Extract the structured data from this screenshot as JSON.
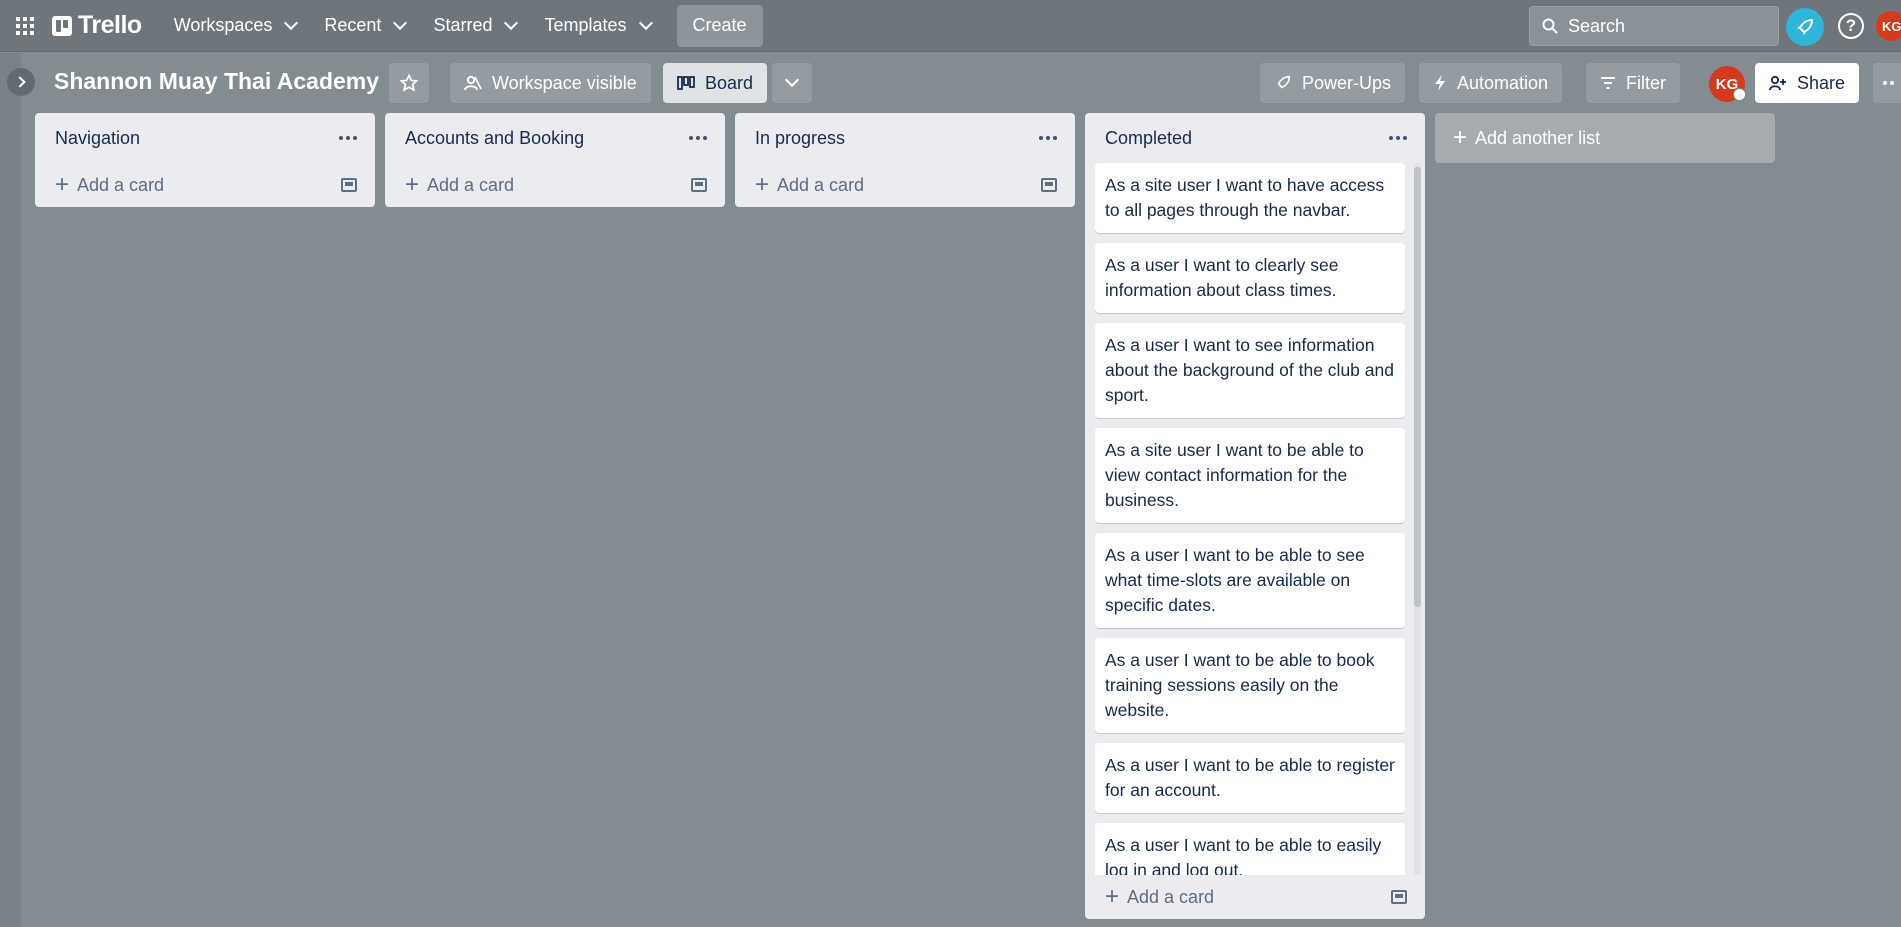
{
  "topbar": {
    "logo_text": "Trello",
    "nav": [
      "Workspaces",
      "Recent",
      "Starred",
      "Templates"
    ],
    "create_label": "Create",
    "search_placeholder": "Search",
    "avatar_initials": "KG"
  },
  "board": {
    "title": "Shannon Muay Thai Academy",
    "visibility_label": "Workspace visible",
    "view_label": "Board",
    "powerups_label": "Power-Ups",
    "automation_label": "Automation",
    "filter_label": "Filter",
    "member_initials": "KG",
    "share_label": "Share",
    "add_list_label": "Add another list"
  },
  "lists": [
    {
      "title": "Navigation",
      "add_card_label": "Add a card",
      "cards": []
    },
    {
      "title": "Accounts and Booking",
      "add_card_label": "Add a card",
      "cards": []
    },
    {
      "title": "In progress",
      "add_card_label": "Add a card",
      "cards": []
    },
    {
      "title": "Completed",
      "add_card_label": "Add a card",
      "cards": [
        "As a site user I want to have access to all pages through the navbar.",
        "As a user I want to clearly see information about class times.",
        "As a user I want to see information about the background of the club and sport.",
        "As a site user I want to be able to view contact information for the business.",
        "As a user I want to be able to see what time-slots are available on specific dates.",
        "As a user I want to be able to book training sessions easily on the website.",
        "As a user I want to be able to register for an account.",
        "As a user I want to be able to easily log in and log out."
      ]
    }
  ],
  "icons": {
    "apps": "apps-grid-icon",
    "search": "search-icon",
    "notifications": "rocket-icon",
    "help": "help-icon",
    "star": "star-icon",
    "visibility": "people-icon",
    "board_view": "board-icon",
    "powerups": "rocket-icon",
    "automation": "lightning-icon",
    "filter": "filter-icon",
    "share": "add-person-icon",
    "more": "ellipsis-icon"
  },
  "colors": {
    "header_bg": "#6e767c",
    "board_bg": "#838c91",
    "avatar": "#d43a1c",
    "accent": "#2fb5d8",
    "list_bg": "#ebecf0"
  }
}
